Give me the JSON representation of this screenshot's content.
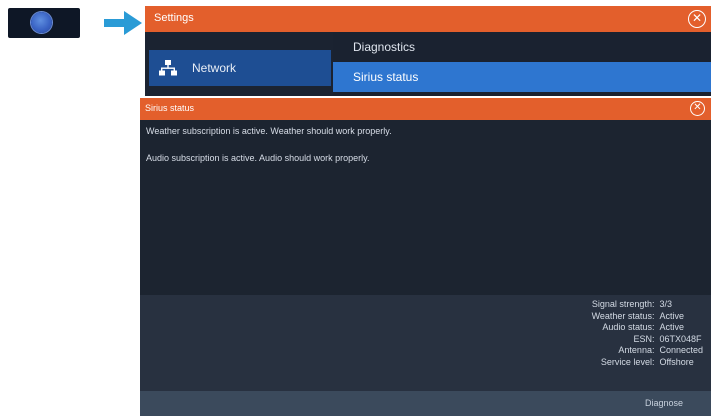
{
  "settings": {
    "title": "Settings",
    "left_menu": [
      {
        "label": "Network",
        "icon": "network-icon"
      }
    ],
    "right_menu": [
      {
        "label": "Diagnostics"
      },
      {
        "label": "Sirius status"
      }
    ],
    "close_icon": "close-icon"
  },
  "dialog": {
    "title": "Sirius status",
    "messages": [
      "Weather subscription is active. Weather should work properly.",
      "Audio subscription is active. Audio should work properly."
    ],
    "status_rows": [
      {
        "key": "Signal strength:",
        "value": "3/3"
      },
      {
        "key": "Weather status:",
        "value": "Active"
      },
      {
        "key": "Audio status:",
        "value": "Active"
      },
      {
        "key": "ESN:",
        "value": "06TX048F"
      },
      {
        "key": "Antenna:",
        "value": "Connected"
      },
      {
        "key": "Service level:",
        "value": "Offshore"
      }
    ],
    "diagnose_label": "Diagnose"
  },
  "colors": {
    "title_bar": "#e35f2c",
    "selected_item": "#2e76d0",
    "network_item": "#1e4e93",
    "window_bg": "#1c2430",
    "arrow": "#2a9bd6"
  }
}
